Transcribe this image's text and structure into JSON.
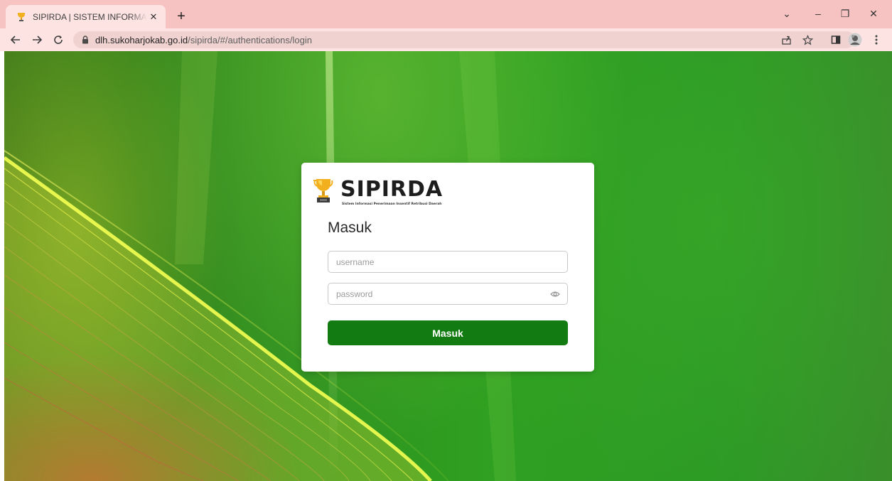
{
  "browser": {
    "tab": {
      "title": "SIPIRDA | SISTEM INFORMASI PENERIMAAN INSENTIF RETRIBUSI DAERAH",
      "favicon": "trophy-icon",
      "close_label": "✕"
    },
    "new_tab_label": "+",
    "window_controls": {
      "minimize": "–",
      "restore": "❐",
      "close": "✕",
      "tab_search": "⌄"
    },
    "url": {
      "host": "dlh.sukoharjokab.go.id",
      "path": "/sipirda/#/authentications/login"
    },
    "icons": [
      "back-icon",
      "forward-icon",
      "reload-icon",
      "lock-icon",
      "share-icon",
      "bookmark-star-icon",
      "side-panel-icon",
      "profile-avatar-icon",
      "menu-kebab-icon"
    ]
  },
  "login": {
    "brand": "SIPIRDA",
    "tagline": "Sistem Informasi Penerimaan Insentif Retribusi Daerah",
    "heading": "Masuk",
    "username_placeholder": "username",
    "password_placeholder": "password",
    "submit_label": "Masuk"
  },
  "colors": {
    "tabbar": "#f6c3c2",
    "toolbar": "#fde4e3",
    "primary_button": "#127c12",
    "trophy_gold": "#f2b01e"
  }
}
